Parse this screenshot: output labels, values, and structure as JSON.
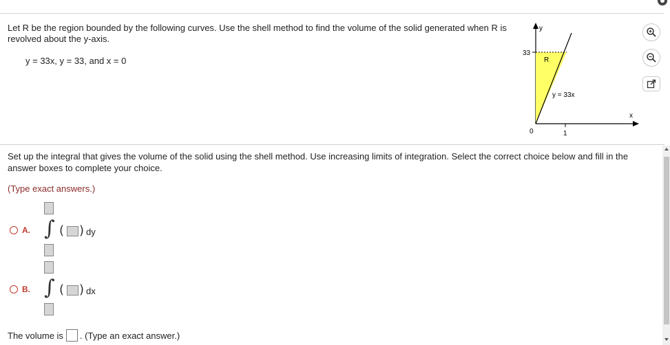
{
  "problem": {
    "text": "Let R be the region bounded by the following curves. Use the shell method to find the volume of the solid generated when R is revolved about the y-axis.",
    "equation": "y = 33x, y = 33, and x = 0"
  },
  "graph": {
    "y_axis_label": "y",
    "x_axis_label": "x",
    "y_tick": "33",
    "origin_label": "0",
    "x_tick": "1",
    "region_label": "R",
    "curve_label": "y = 33x",
    "fill_color": "#ffff66"
  },
  "tools": {
    "zoom_in_icon": "zoom-in-icon",
    "zoom_out_icon": "zoom-out-icon",
    "popout_icon": "external-link-icon"
  },
  "question": {
    "instruction": "Set up the integral that gives the volume of the solid using the shell method. Use increasing limits of integration. Select the correct choice below and fill in the answer boxes to complete your choice.",
    "hint": "(Type exact answers.)"
  },
  "choices": [
    {
      "label": "A.",
      "variable": "dy"
    },
    {
      "label": "B.",
      "variable": "dx"
    }
  ],
  "volume": {
    "prefix": "The volume is",
    "suffix": ". (Type an exact answer.)"
  },
  "colors": {
    "accent": "#c0392b",
    "hint": "#8b2a2a"
  }
}
